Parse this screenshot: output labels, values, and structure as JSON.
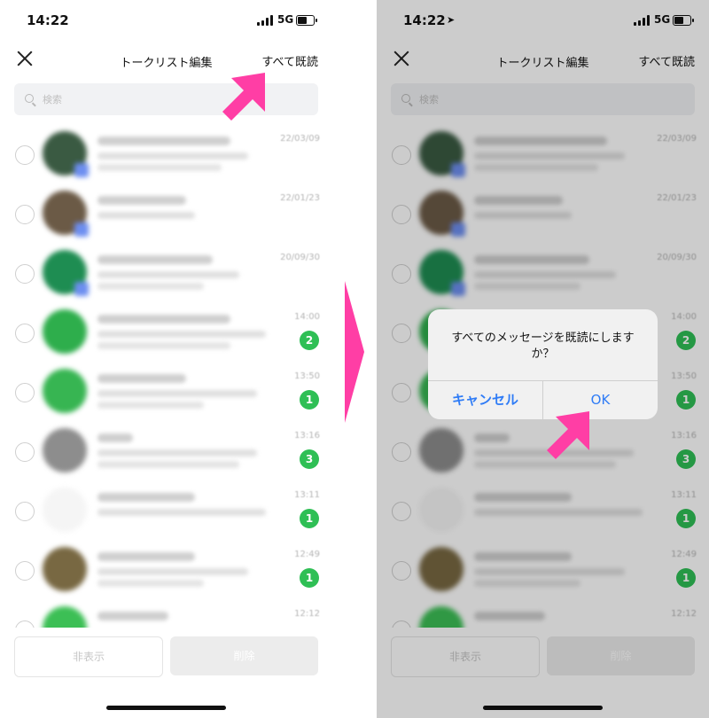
{
  "status": {
    "time": "14:22",
    "network": "5G"
  },
  "nav": {
    "title": "トークリスト編集",
    "mark_all": "すべて既読"
  },
  "search": {
    "placeholder": "検索"
  },
  "rows": [
    {
      "time": "22/03/09",
      "badge": "",
      "avatar": "#3a5a42",
      "line1": 150,
      "line2": 170,
      "line3": 140
    },
    {
      "time": "22/01/23",
      "badge": "",
      "avatar": "#6b5a46",
      "line1": 100,
      "line2": 110,
      "line3": 0
    },
    {
      "time": "20/09/30",
      "badge": "",
      "avatar": "#1e8d52",
      "line1": 130,
      "line2": 160,
      "line3": 120
    },
    {
      "time": "14:00",
      "badge": "2",
      "avatar": "#2eae4c",
      "line1": 150,
      "line2": 190,
      "line3": 150
    },
    {
      "time": "13:50",
      "badge": "1",
      "avatar": "#37b552",
      "line1": 100,
      "line2": 180,
      "line3": 120
    },
    {
      "time": "13:16",
      "badge": "3",
      "avatar": "#8d8d8d",
      "line1": 40,
      "line2": 180,
      "line3": 160
    },
    {
      "time": "13:11",
      "badge": "1",
      "avatar": "#f5f5f5",
      "line1": 110,
      "line2": 190,
      "line3": 0
    },
    {
      "time": "12:49",
      "badge": "1",
      "avatar": "#786842",
      "line1": 110,
      "line2": 170,
      "line3": 120
    },
    {
      "time": "12:12",
      "badge": "",
      "avatar": "#3cbf55",
      "line1": 80,
      "line2": 0,
      "line3": 0
    }
  ],
  "bottom": {
    "hide": "非表示",
    "delete": "削除"
  },
  "dialog": {
    "message": "すべてのメッセージを既読にしますか？",
    "cancel": "キャンセル",
    "ok": "OK"
  },
  "colors": {
    "accent_pink": "#ff3ea5",
    "line_green": "#2fbf55",
    "ios_blue": "#2f7cf6"
  }
}
